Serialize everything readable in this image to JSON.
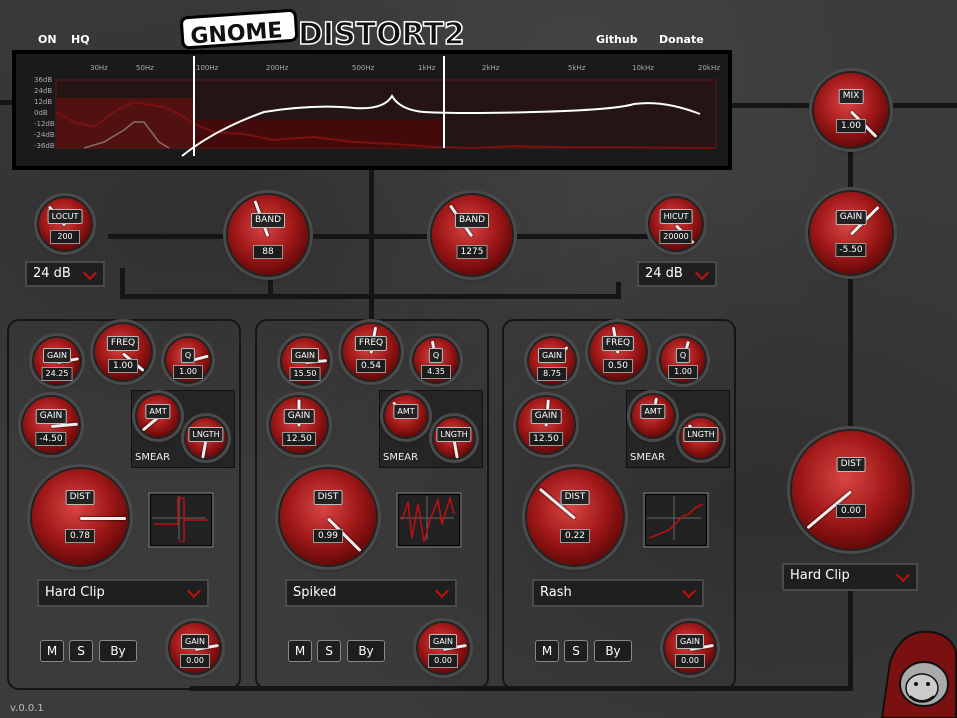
{
  "header": {
    "on_label": "ON",
    "hq_label": "HQ",
    "github_label": "Github",
    "donate_label": "Donate",
    "logo_text_1": "GNOME",
    "logo_text_2": "DISTORT2"
  },
  "spectrum": {
    "freq_labels": [
      "30Hz",
      "50Hz",
      "100Hz",
      "200Hz",
      "500Hz",
      "1kHz",
      "2kHz",
      "5kHz",
      "10kHz",
      "20kHz"
    ],
    "db_labels": [
      "36dB",
      "24dB",
      "12dB",
      "0dB",
      "-12dB",
      "-24dB",
      "-36dB"
    ]
  },
  "global": {
    "locut": {
      "label": "LOCUT",
      "value": "200"
    },
    "band1": {
      "label": "BAND",
      "value": "88"
    },
    "band2": {
      "label": "BAND",
      "value": "1275"
    },
    "hicut": {
      "label": "HICUT",
      "value": "20000"
    },
    "locut_slope": "24 dB",
    "hicut_slope": "24 dB",
    "mix": {
      "label": "MIX",
      "value": "1.00"
    },
    "out_gain": {
      "label": "GAIN",
      "value": "-5.50"
    },
    "out_dist": {
      "label": "DIST",
      "value": "0.00"
    },
    "out_type": "Hard Clip"
  },
  "bands": [
    {
      "gain": {
        "label": "GAIN",
        "value": "24.25"
      },
      "freq": {
        "label": "FREQ",
        "value": "1.00"
      },
      "q": {
        "label": "Q",
        "value": "1.00"
      },
      "pregain": {
        "label": "GAIN",
        "value": "-4.50"
      },
      "amt": {
        "label": "AMT"
      },
      "lngth": {
        "label": "LNGTH"
      },
      "smear_label": "SMEAR",
      "dist": {
        "label": "DIST",
        "value": "0.78"
      },
      "type": "Hard Clip",
      "m_label": "M",
      "s_label": "S",
      "by_label": "By",
      "outgain": {
        "label": "GAIN",
        "value": "0.00"
      }
    },
    {
      "gain": {
        "label": "GAIN",
        "value": "15.50"
      },
      "freq": {
        "label": "FREQ",
        "value": "0.54"
      },
      "q": {
        "label": "Q",
        "value": "4.35"
      },
      "pregain": {
        "label": "GAIN",
        "value": "12.50"
      },
      "amt": {
        "label": "AMT"
      },
      "lngth": {
        "label": "LNGTH"
      },
      "smear_label": "SMEAR",
      "dist": {
        "label": "DIST",
        "value": "0.99"
      },
      "type": "Spiked",
      "m_label": "M",
      "s_label": "S",
      "by_label": "By",
      "outgain": {
        "label": "GAIN",
        "value": "0.00"
      }
    },
    {
      "gain": {
        "label": "GAIN",
        "value": "8.75"
      },
      "freq": {
        "label": "FREQ",
        "value": "0.50"
      },
      "q": {
        "label": "Q",
        "value": "1.00"
      },
      "pregain": {
        "label": "GAIN",
        "value": "12.50"
      },
      "amt": {
        "label": "AMT"
      },
      "lngth": {
        "label": "LNGTH"
      },
      "smear_label": "SMEAR",
      "dist": {
        "label": "DIST",
        "value": "0.22"
      },
      "type": "Rash",
      "m_label": "M",
      "s_label": "S",
      "by_label": "By",
      "outgain": {
        "label": "GAIN",
        "value": "0.00"
      }
    }
  ],
  "version": "v.0.0.1",
  "colors": {
    "accent": "#c01010",
    "knob": "#a01818",
    "background": "#3b3b3b"
  }
}
